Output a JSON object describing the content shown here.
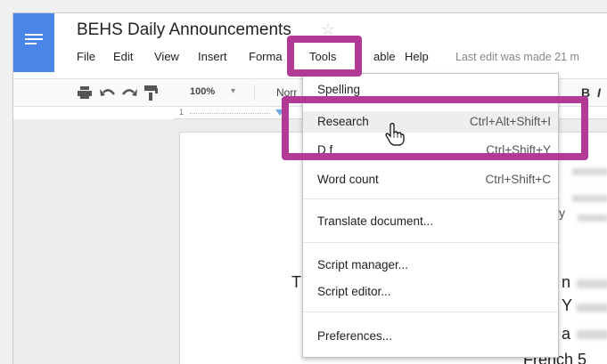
{
  "doc": {
    "title": "BEHS Daily Announcements",
    "star": "☆",
    "last_edit": "Last edit was made 21 m"
  },
  "menu": [
    "File",
    "Edit",
    "View",
    "Insert",
    "Forma",
    "Tools",
    "able",
    "Help"
  ],
  "toolbar": {
    "zoom": "100%",
    "style_partial": "Norr",
    "bold": "B",
    "italic": "I"
  },
  "ruler": {
    "mark": "1"
  },
  "tools_menu": {
    "items": [
      {
        "label": "Spelling",
        "shortcut": ""
      },
      {
        "label": "Research",
        "shortcut": "Ctrl+Alt+Shift+I"
      },
      {
        "label": "D f",
        "shortcut": "Ctrl+Shift+Y"
      },
      {
        "label": "Word count",
        "shortcut": "Ctrl+Shift+C"
      },
      {
        "label": "Translate document...",
        "shortcut": ""
      },
      {
        "label": "Script manager...",
        "shortcut": ""
      },
      {
        "label": "Script editor...",
        "shortcut": ""
      },
      {
        "label": "Preferences...",
        "shortcut": ""
      }
    ]
  },
  "page_text": {
    "left_char": "T",
    "right_chars": [
      "n",
      "Y",
      "a",
      "French 5"
    ],
    "fragment": "y"
  },
  "colors": {
    "highlight_box": "#b03a94",
    "docs_blue": "#4a86e8"
  },
  "icons": [
    "docs-logo-icon",
    "star-icon",
    "print-icon",
    "undo-icon",
    "redo-icon",
    "paint-format-icon",
    "hand-cursor-icon"
  ]
}
